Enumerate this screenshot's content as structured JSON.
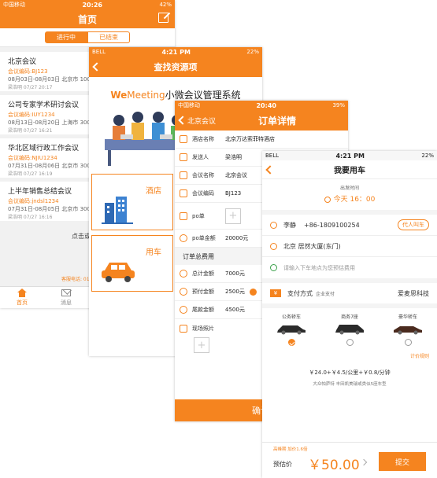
{
  "screen1": {
    "status": {
      "carrier": "中国移动",
      "time": "20:26",
      "battery": "42%"
    },
    "title": "首页",
    "segments": [
      "进行中",
      "已结束"
    ],
    "meetings": [
      {
        "title": "北京会议",
        "code": "会议编码:BJ123",
        "dates": "08月03日-08月03日 北京市 100人",
        "created": "梁浩明 07/27 20:17"
      },
      {
        "title": "公司专家学术研讨会议",
        "code": "会议编码:IUY1234",
        "dates": "08月13日-08月20日 上海市 300人",
        "created": "梁浩明 07/27 16:21"
      },
      {
        "title": "华北区域行政工作会议",
        "code": "会议编码:NJIU1234",
        "dates": "07月31日-08月06日 北京市 300人",
        "created": "梁浩明 07/27 16:19"
      },
      {
        "title": "上半年销售总结会议",
        "code": "会议编码:jndsl1234",
        "dates": "07月31日-08月05日 北京市 300人",
        "created": "梁浩明 07/27 16:16"
      }
    ],
    "load_more": "点击或上拉",
    "hotline": "客服电话: 010",
    "tabs": [
      "首页",
      "消息"
    ]
  },
  "screen2": {
    "status": {
      "carrier": "BELL",
      "time": "4:21 PM",
      "battery": "22%"
    },
    "title": "查找资源项",
    "brand_we": "We",
    "brand_meeting": "Meeting",
    "brand_rest": "小微会议管理系统",
    "hotel_label": "酒店",
    "car_label": "用车"
  },
  "screen3": {
    "status": {
      "carrier": "中国移动",
      "time": "20:40",
      "battery": "39%"
    },
    "back_label": "北京会议",
    "title": "订单详情",
    "rows": [
      {
        "label": "酒店名称",
        "value": "北京万达索菲特酒店"
      },
      {
        "label": "发送人",
        "value": "梁浩明"
      },
      {
        "label": "会议名称",
        "value": "北京会议"
      },
      {
        "label": "会议编码",
        "value": "BJ123"
      }
    ],
    "po_label": "po单",
    "po_amount_label": "po单金额",
    "po_amount": "20000元",
    "section": "订单总费用",
    "fees": [
      {
        "label": "总计金额",
        "value": "7000元"
      },
      {
        "label": "预付金额",
        "value": "2500元"
      },
      {
        "label": "尾款金额",
        "value": "4500元"
      }
    ],
    "photo_label": "现场照片",
    "confirm": "确认"
  },
  "screen4": {
    "status": {
      "carrier": "BELL",
      "time": "4:21 PM",
      "battery": "22%"
    },
    "title": "我要用车",
    "depart_label": "出发时间",
    "depart_value": "今天 16：00",
    "passenger": "李静",
    "phone": "+86-1809100254",
    "proxy_button": "代人叫车",
    "from": "北京 居然大厦(东门)",
    "to_placeholder": "请输入下车地点为您预估费用",
    "pay_label": "支付方式",
    "pay_sub": "企业支付",
    "company": "爱麦思科技",
    "cars": [
      "公务轿车",
      "商务7座",
      "豪华轿车"
    ],
    "price_rule": "计价规则",
    "formula": "￥24.0+￥4.5/公里+￥0.8/分钟",
    "hint": "大众帕萨特 丰田凯美瑞或类似5座车型",
    "peak": "高峰期 加价1.6倍",
    "estimate_label": "预估价",
    "estimate_value": "￥50.00",
    "submit": "提交"
  }
}
